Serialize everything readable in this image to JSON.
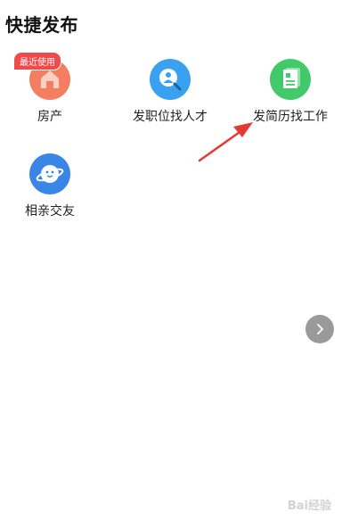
{
  "header": {
    "title": "快捷发布"
  },
  "items": [
    {
      "label": "房产",
      "badge": "最近使用",
      "icon": "house-icon",
      "color": "#f47f60"
    },
    {
      "label": "发职位找人才",
      "icon": "recruit-search-icon",
      "color": "#3aa0f0"
    },
    {
      "label": "发简历找工作",
      "icon": "resume-icon",
      "color": "#42c96a"
    },
    {
      "label": "相亲交友",
      "icon": "planet-icon",
      "color": "#3a86e8"
    }
  ],
  "annotation": {
    "arrow_color": "#e53935"
  },
  "watermark": "Bai经验"
}
